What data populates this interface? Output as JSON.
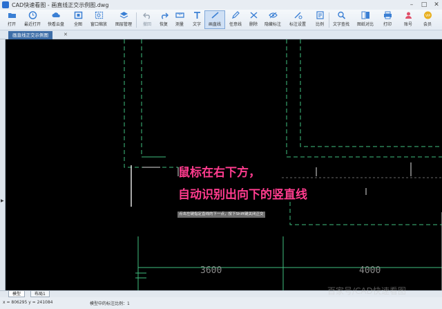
{
  "window": {
    "title": "CAD快速看图 - 画直线正交示例图.dwg"
  },
  "toolbar": {
    "buttons": [
      {
        "id": "open",
        "label": "打开",
        "icon": "folder-icon"
      },
      {
        "id": "recent",
        "label": "最近打开",
        "icon": "clock-icon"
      },
      {
        "id": "cloud",
        "label": "快看云盘",
        "icon": "cloud-icon"
      },
      {
        "id": "fullview",
        "label": "全图",
        "icon": "fit-view-icon"
      },
      {
        "id": "window-zoom",
        "label": "窗口缩放",
        "icon": "window-zoom-icon"
      },
      {
        "id": "layers",
        "label": "图层管理",
        "icon": "layers-icon"
      },
      {
        "id": "undo",
        "label": "撤回",
        "icon": "undo-icon"
      },
      {
        "id": "redo",
        "label": "恢复",
        "icon": "redo-icon"
      },
      {
        "id": "measure",
        "label": "测量",
        "icon": "measure-icon"
      },
      {
        "id": "text",
        "label": "文字",
        "icon": "text-icon"
      },
      {
        "id": "line",
        "label": "画直线",
        "icon": "line-icon"
      },
      {
        "id": "polyline",
        "label": "任意线",
        "icon": "pencil-icon"
      },
      {
        "id": "delete",
        "label": "删除",
        "icon": "delete-icon"
      },
      {
        "id": "hide-annot",
        "label": "隐藏标注",
        "icon": "eye-icon"
      },
      {
        "id": "annot-settings",
        "label": "标注设置",
        "icon": "annotation-settings-icon"
      },
      {
        "id": "scale",
        "label": "比例",
        "icon": "scale-icon"
      },
      {
        "id": "text-search",
        "label": "文字查找",
        "icon": "search-icon"
      },
      {
        "id": "compare",
        "label": "图纸对比",
        "icon": "compare-icon"
      },
      {
        "id": "print",
        "label": "打印",
        "icon": "print-icon"
      },
      {
        "id": "account",
        "label": "账号",
        "icon": "user-icon"
      },
      {
        "id": "vip",
        "label": "会员",
        "icon": "vip-icon"
      }
    ]
  },
  "tabs": {
    "document": "画直线正交示例图"
  },
  "canvas": {
    "overlay_line1": "鼠标在右下方，",
    "overlay_line2": "自动识别出向下的竖直线",
    "prompt": "点击左键指定直线的下一点，按下Shift键关闭正交",
    "dim_left": "3600",
    "dim_right": "4000"
  },
  "layout_tabs": [
    "模型",
    "布局1"
  ],
  "status": {
    "coords": "x = 806295  y = 241084",
    "message": "模型中的标注比例：1"
  },
  "watermark": "百家号/CAD快速看图",
  "colors": {
    "canvas": "#000000",
    "overlay_text": "#ff3c8e",
    "cad_green": "#3fbf7f",
    "cad_white": "#e0e0e0"
  }
}
